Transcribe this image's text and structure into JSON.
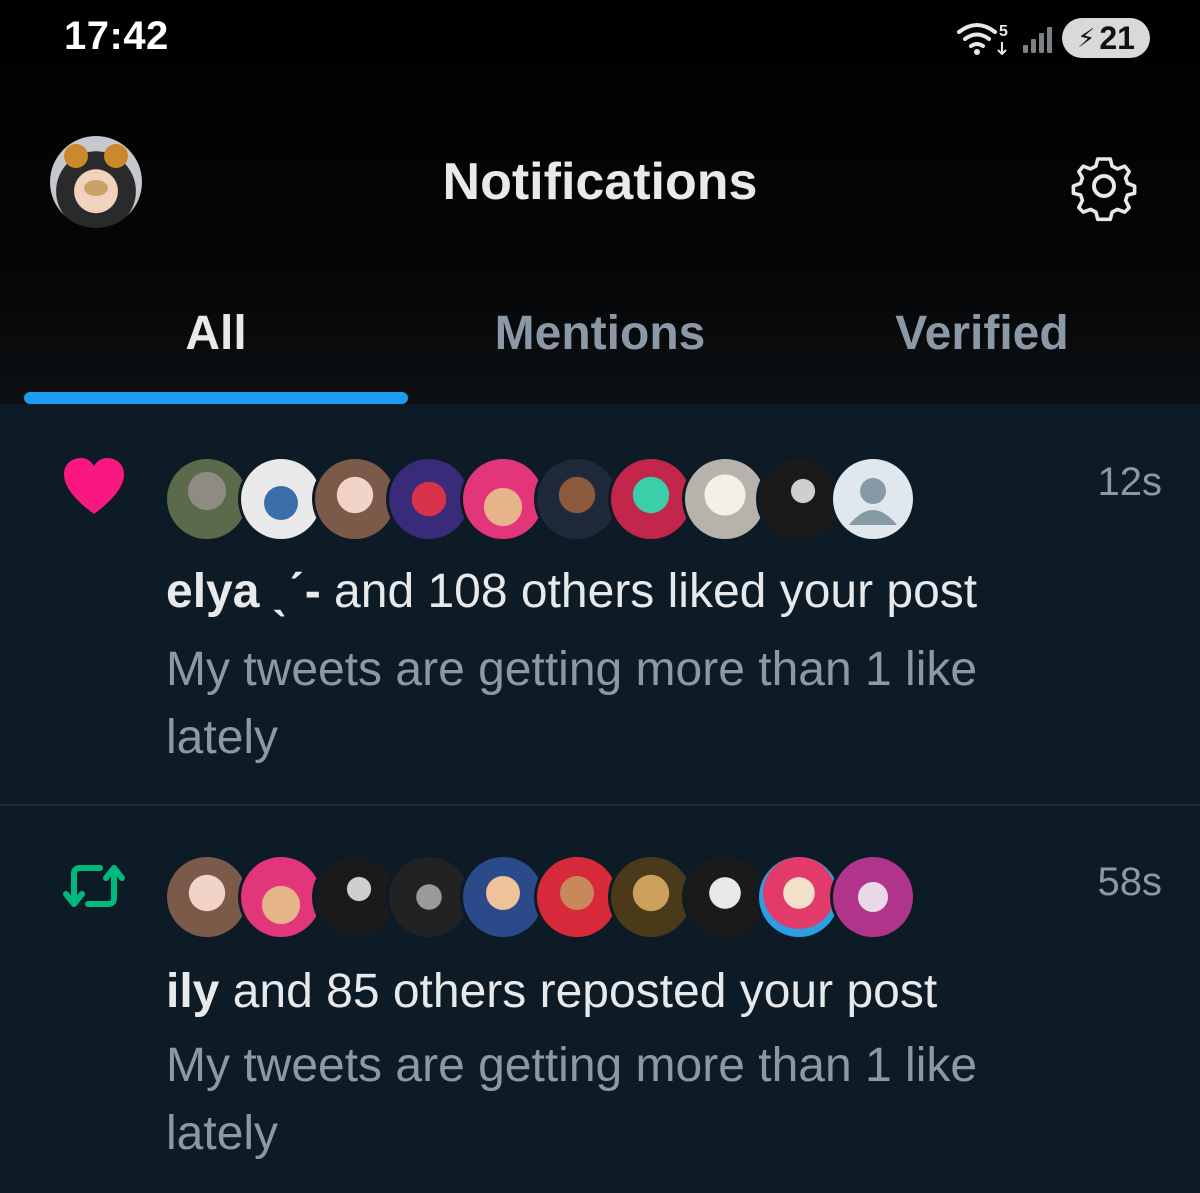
{
  "status_bar": {
    "time": "17:42",
    "network_label": "5",
    "battery_level": "21"
  },
  "header": {
    "title": "Notifications",
    "settings_icon": "gear-icon",
    "avatar_icon": "bear-filter-avatar"
  },
  "tabs": [
    {
      "label": "All",
      "active": true
    },
    {
      "label": "Mentions",
      "active": false
    },
    {
      "label": "Verified",
      "active": false
    }
  ],
  "notifications": [
    {
      "type": "like",
      "icon": "heart-icon",
      "icon_color": "#f91880",
      "time": "12s",
      "actor": "elya ˎˊ-",
      "action": " and 108 others liked your post",
      "snippet": "My tweets are getting more than 1 like lately"
    },
    {
      "type": "repost",
      "icon": "repost-icon",
      "icon_color": "#00ba7c",
      "time": "58s",
      "actor": "ily",
      "action": " and 85 others reposted your post",
      "snippet": "My tweets are getting more than 1 like lately"
    }
  ],
  "colors": {
    "accent": "#1d9bf0",
    "feed_background": "#0d1b26",
    "primary_text": "#e7e9ea",
    "secondary_text": "#8b98a5"
  }
}
